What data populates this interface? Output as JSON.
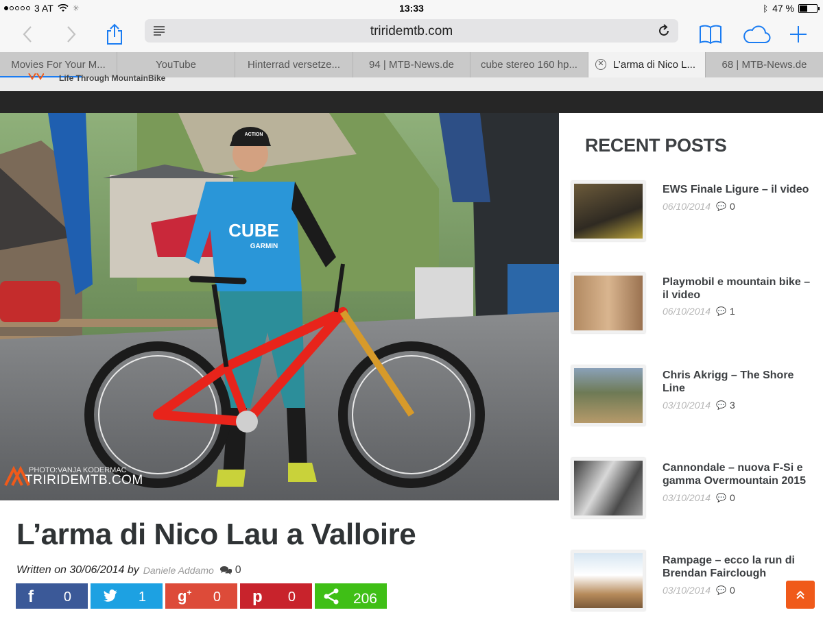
{
  "status_bar": {
    "carrier": "3 AT",
    "time": "13:33",
    "battery": "47 %"
  },
  "toolbar": {
    "url": "triridemtb.com"
  },
  "tabs": [
    {
      "label": "Movies For Your M..."
    },
    {
      "label": "YouTube"
    },
    {
      "label": "Hinterrad versetze..."
    },
    {
      "label": "94 | MTB-News.de"
    },
    {
      "label": "cube stereo 160 hp..."
    },
    {
      "label": "L’arma di Nico L..."
    },
    {
      "label": "68 | MTB-News.de"
    }
  ],
  "site": {
    "tagline": "Life Through MountainBike"
  },
  "hero": {
    "photo_credit": "PHOTO:VANJA KODERMAC",
    "watermark": "TRIRIDEMTB.COM",
    "jersey_text": "CUBE",
    "sponsor": "GARMIN",
    "cap_text": "ACTION"
  },
  "article": {
    "title": "L’arma di Nico Lau a Valloire",
    "written_on": "Written on 30/06/2014 by",
    "author": "Daniele Addamo",
    "comment_count": "0",
    "shares": {
      "facebook": "0",
      "twitter": "1",
      "googleplus": "0",
      "pinterest": "0",
      "total": "206"
    }
  },
  "sidebar": {
    "title": "RECENT POSTS",
    "posts": [
      {
        "title": "EWS Finale Ligure – il video",
        "date": "06/10/2014",
        "comments": "0"
      },
      {
        "title": "Playmobil e mountain bike – il video",
        "date": "06/10/2014",
        "comments": "1"
      },
      {
        "title": "Chris Akrigg – The Shore Line",
        "date": "03/10/2014",
        "comments": "3"
      },
      {
        "title": "Cannondale – nuova F-Si e gamma Overmountain 2015",
        "date": "03/10/2014",
        "comments": "0"
      },
      {
        "title": "Rampage – ecco la run di Brendan Fairclough",
        "date": "03/10/2014",
        "comments": "0"
      }
    ]
  },
  "colors": {
    "accent": "#1a7cf2",
    "facebook": "#3b5998",
    "twitter": "#1da1e2",
    "googleplus": "#dd4b39",
    "pinterest": "#c8232c",
    "share_total": "#3fbf16",
    "back_to_top": "#f05a1a"
  }
}
